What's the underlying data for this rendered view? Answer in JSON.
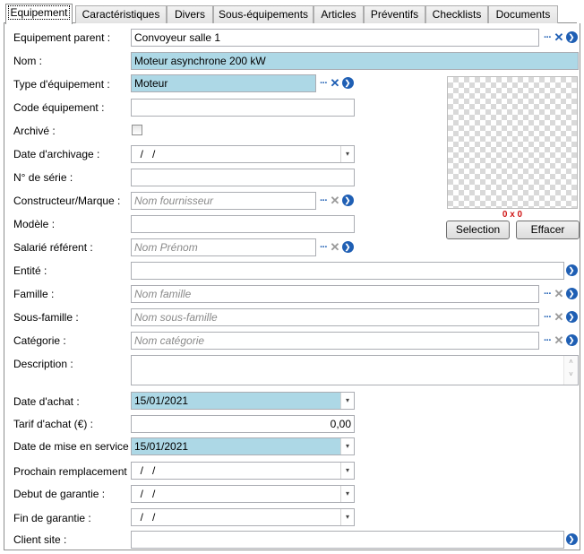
{
  "tabs": [
    "Equipement",
    "Caractéristiques",
    "Divers",
    "Sous-équipements",
    "Articles",
    "Préventifs",
    "Checklists",
    "Documents"
  ],
  "labels": {
    "equipement_parent": "Equipement parent :",
    "nom": "Nom :",
    "type": "Type d'équipement :",
    "code": "Code équipement :",
    "archive": "Archivé :",
    "date_archivage": "Date d'archivage :",
    "serie": "N° de série :",
    "constructeur": "Constructeur/Marque :",
    "modele": "Modèle :",
    "salarie": "Salarié référent :",
    "entite": "Entité :",
    "famille": "Famille :",
    "sous_famille": "Sous-famille :",
    "categorie": "Catégorie :",
    "description": "Description :",
    "date_achat": "Date d'achat :",
    "tarif": "Tarif d'achat (€) :",
    "date_service": "Date de mise en service :",
    "prochain": "Prochain remplacement :",
    "debut_garantie": "Debut de garantie :",
    "fin_garantie": "Fin de garantie :",
    "client_site": "Client site :"
  },
  "values": {
    "equipement_parent": "Convoyeur salle 1",
    "nom": "Moteur asynchrone 200 kW",
    "type": "Moteur",
    "code": "",
    "date_archivage": "  /   /",
    "serie": "",
    "constructeur_placeholder": "Nom fournisseur",
    "modele": "",
    "salarie_placeholder": "Nom Prénom",
    "entite": "",
    "famille_placeholder": "Nom famille",
    "sous_famille_placeholder": "Nom sous-famille",
    "categorie_placeholder": "Nom catégorie",
    "description": "",
    "date_achat": "15/01/2021",
    "tarif": "0,00",
    "date_service": "15/01/2021",
    "prochain": "  /   /",
    "debut_garantie": "  /   /",
    "fin_garantie": "  /   /",
    "client_site": ""
  },
  "archive_checked": false,
  "photo": {
    "dims": "0 x 0",
    "select_label": "Selection",
    "clear_label": "Effacer"
  },
  "icons": {
    "dots": "···",
    "clear": "✕",
    "go": "❯",
    "dropdown": "▾",
    "scroll_up": "˄",
    "scroll_down": "˅"
  },
  "colors": {
    "highlight": "#add8e6",
    "accent": "#1f5fb4",
    "dims": "#d01818"
  }
}
